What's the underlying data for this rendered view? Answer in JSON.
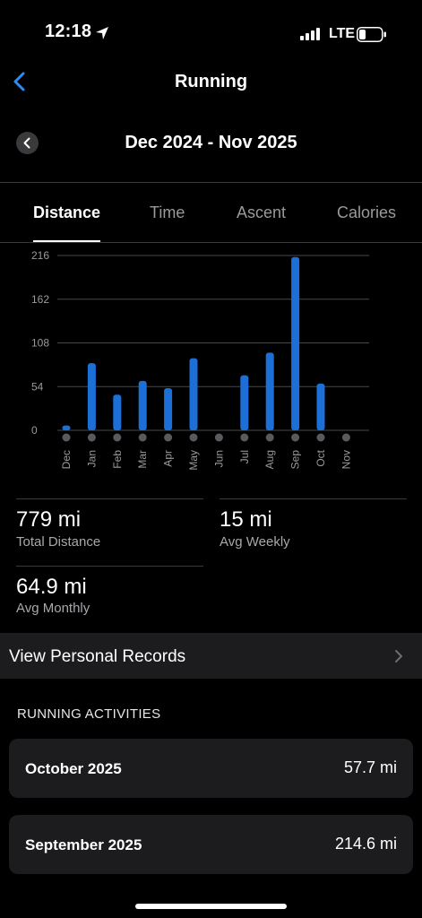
{
  "status_bar": {
    "time": "12:18",
    "network": "LTE",
    "icons": [
      "location-arrow-icon",
      "signal-bars-icon",
      "battery-icon"
    ]
  },
  "header": {
    "title": "Running",
    "period": "Dec 2024 - Nov 2025"
  },
  "tabs": [
    {
      "label": "Distance",
      "active": true
    },
    {
      "label": "Time",
      "active": false
    },
    {
      "label": "Ascent",
      "active": false
    },
    {
      "label": "Calories",
      "active": false
    }
  ],
  "chart_data": {
    "type": "bar",
    "categories": [
      "Dec",
      "Jan",
      "Feb",
      "Mar",
      "Apr",
      "May",
      "Jun",
      "Jul",
      "Aug",
      "Sep",
      "Oct",
      "Nov"
    ],
    "values": [
      6,
      83,
      44,
      61,
      52,
      89,
      0,
      68,
      96,
      214,
      57.7,
      0
    ],
    "y_ticks": [
      0,
      54,
      108,
      162,
      216
    ],
    "ylim": [
      0,
      216
    ],
    "grid": true,
    "bar_color": "#1c6fd6"
  },
  "stats": [
    {
      "value": "779 mi",
      "label": "Total Distance"
    },
    {
      "value": "15 mi",
      "label": "Avg Weekly"
    },
    {
      "value": "64.9 mi",
      "label": "Avg Monthly"
    }
  ],
  "records": {
    "label": "View Personal Records"
  },
  "activities": {
    "section_title": "RUNNING ACTIVITIES",
    "items": [
      {
        "month": "October 2025",
        "distance": "57.7 mi"
      },
      {
        "month": "September 2025",
        "distance": "214.6 mi"
      }
    ]
  }
}
